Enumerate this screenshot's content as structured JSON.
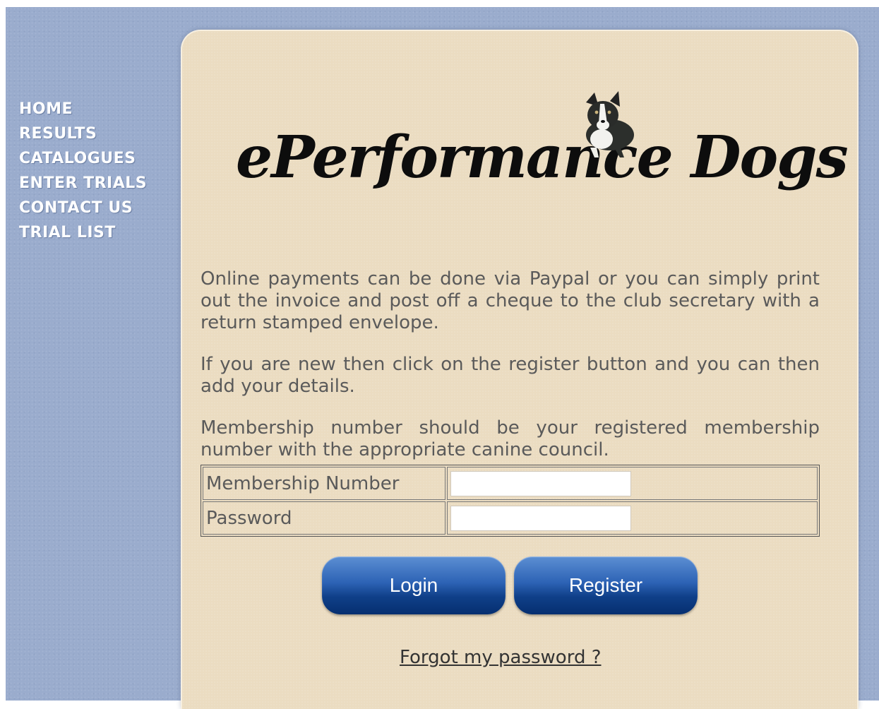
{
  "nav": {
    "items": [
      {
        "label": "HOME"
      },
      {
        "label": "RESULTS"
      },
      {
        "label": "CATALOGUES"
      },
      {
        "label": "ENTER TRIALS"
      },
      {
        "label": "CONTACT US"
      },
      {
        "label": "TRIAL LIST"
      }
    ]
  },
  "logo": {
    "text": "ePerformance Dogs",
    "icon": "border-collie-dog-photo"
  },
  "content": {
    "paragraphs": [
      "Online payments can be done via Paypal or you can simply print out the invoice and post off a cheque to the club secretary with a return stamped envelope.",
      "If you are new then click on the register button and you can then add your details.",
      "Membership number should be your registered membership number with the appropriate canine council."
    ]
  },
  "form": {
    "membership_label": "Membership Number",
    "membership_value": "",
    "password_label": "Password",
    "password_value": ""
  },
  "buttons": {
    "login": "Login",
    "register": "Register"
  },
  "links": {
    "forgot": "Forgot my password ?"
  },
  "colors": {
    "page_background": "#9aaccd",
    "panel_background": "#ebdcc1",
    "button_blue": "#0f3f88",
    "nav_text": "#ffffff",
    "body_text": "#5a5a5a"
  }
}
